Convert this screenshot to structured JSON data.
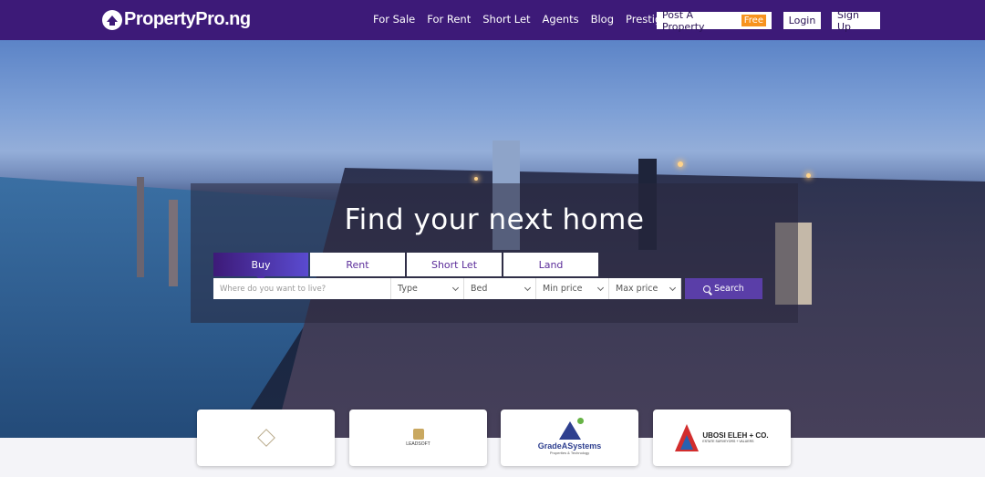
{
  "brand": {
    "name": "PropertyPro.ng"
  },
  "nav": {
    "links": [
      "For Sale",
      "For Rent",
      "Short Let",
      "Agents",
      "Blog",
      "Prestige"
    ],
    "post_property": "Post A Property",
    "free_badge": "Free",
    "login": "Login",
    "signup": "Sign Up"
  },
  "hero": {
    "title": "Find your next home",
    "tabs": [
      "Buy",
      "Rent",
      "Short Let",
      "Land"
    ],
    "active_tab": "Buy",
    "location_placeholder": "Where do you want to live?",
    "type_label": "Type",
    "bed_label": "Bed",
    "min_price_label": "Min price",
    "max_price_label": "Max price",
    "search_label": "Search"
  },
  "partners": [
    {
      "name": "partner-1",
      "text": ""
    },
    {
      "name": "partner-2",
      "text": "LEADSOFT"
    },
    {
      "name": "partner-3",
      "text": "GradeASystems",
      "sub": "Properties & Technology"
    },
    {
      "name": "partner-4",
      "text": "UBOSI ELEH + CO.",
      "sub": "ESTATE SURVEYORS + VALUERS"
    }
  ],
  "colors": {
    "nav_bg": "#3d1a78",
    "accent": "#5a3ea8",
    "free_badge": "#f7931e"
  }
}
